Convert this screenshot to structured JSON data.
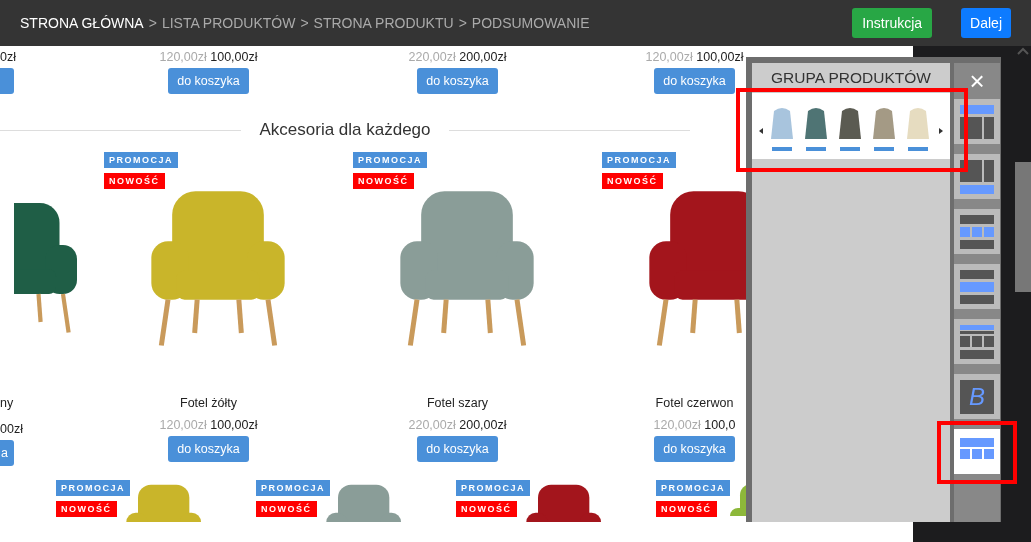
{
  "breadcrumb": [
    {
      "kind": "step",
      "label": "STRONA GŁÓWNA",
      "selected": true
    },
    {
      "kind": "separator",
      "label": ">"
    },
    {
      "kind": "step",
      "label": "LISTA PRODUKTÓW",
      "selected": false
    },
    {
      "kind": "separator",
      "label": ">"
    },
    {
      "kind": "step",
      "label": "STRONA PRODUKTU",
      "selected": false
    },
    {
      "kind": "separator",
      "label": ">"
    },
    {
      "kind": "step",
      "label": "PODSUMOWANIE",
      "selected": false
    }
  ],
  "buttons": [
    {
      "kind": "success",
      "label": "Instrukcja"
    },
    {
      "kind": "primary",
      "label": "Dalej"
    }
  ],
  "top_row": [
    {
      "kind": "partial",
      "new_price": "0zł"
    },
    {
      "kind": "full",
      "old_price": "120,00zł",
      "new_price": "100,00zł",
      "button": "do koszyka"
    },
    {
      "kind": "full",
      "old_price": "220,00zł",
      "new_price": "200,00zł",
      "button": "do koszyka"
    },
    {
      "kind": "full",
      "old_price": "120,00zł",
      "new_price": "100,00zł",
      "button": "do koszyka"
    }
  ],
  "section_title": "Akcesoria dla każdego",
  "products": [
    {
      "kind": "partial",
      "color": "#1f5e46",
      "name": "ny",
      "new_price": "00zł",
      "button": "a"
    },
    {
      "kind": "full",
      "color": "#c9b52a",
      "badges": [
        "PROMOCJA",
        "NOWOŚĆ"
      ],
      "name": "Fotel żółty",
      "old_price": "120,00zł",
      "new_price": "100,00zł",
      "button": "do koszyka"
    },
    {
      "kind": "full",
      "color": "#8a9d98",
      "badges": [
        "PROMOCJA",
        "NOWOŚĆ"
      ],
      "name": "Fotel szary",
      "old_price": "220,00zł",
      "new_price": "200,00zł",
      "button": "do koszyka"
    },
    {
      "kind": "full",
      "color": "#a3151c",
      "badges": [
        "PROMOCJA",
        "NOWOŚĆ"
      ],
      "name": "Fotel czerwon",
      "old_price": "120,00zł",
      "new_price": "100,0",
      "button": "do koszyka"
    }
  ],
  "bottom_row": [
    {
      "color": "#c9b52a",
      "badges": [
        "PROMOCJA",
        "NOWOŚĆ"
      ]
    },
    {
      "color": "#8a9d98",
      "badges": [
        "PROMOCJA",
        "NOWOŚĆ"
      ]
    },
    {
      "color": "#a3151c",
      "badges": [
        "PROMOCJA",
        "NOWOŚĆ"
      ]
    },
    {
      "color": "#8db83a",
      "badges": [
        "PROMOCJA",
        "NOWOŚĆ"
      ]
    }
  ],
  "panel": {
    "title": "GRUPA PRODUKTÓW",
    "close": "×",
    "layouts": [
      {
        "kind": "top-two",
        "selected": false
      },
      {
        "kind": "two-bottom",
        "selected": false
      },
      {
        "kind": "three-middle",
        "selected": false
      },
      {
        "kind": "wide-middle",
        "selected": false
      },
      {
        "kind": "strip-top",
        "selected": false
      },
      {
        "kind": "text",
        "label": "B",
        "selected": false
      },
      {
        "kind": "grid",
        "selected": true
      }
    ]
  }
}
